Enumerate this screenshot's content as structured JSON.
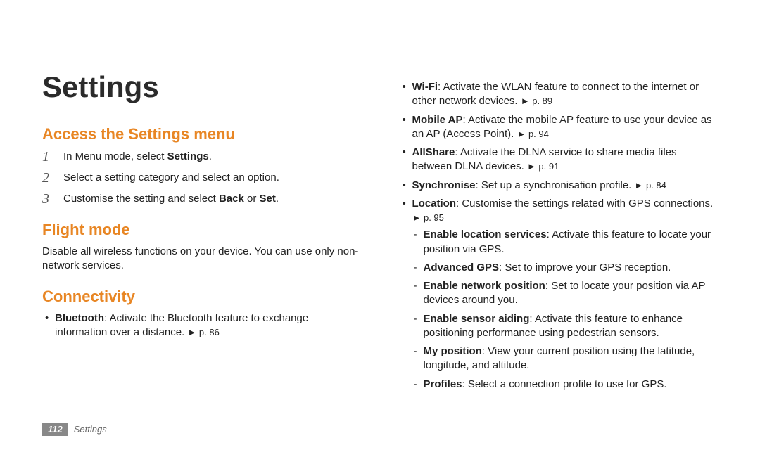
{
  "title": "Settings",
  "sections": {
    "access": {
      "heading": "Access the Settings menu",
      "steps": [
        {
          "n": "1",
          "pre": "In Menu mode, select ",
          "bold": "Settings",
          "post": "."
        },
        {
          "n": "2",
          "pre": "Select a setting category and select an option.",
          "bold": "",
          "post": ""
        },
        {
          "n": "3",
          "pre": "Customise the setting and select ",
          "bold": "Back",
          "mid": " or ",
          "bold2": "Set",
          "post": "."
        }
      ]
    },
    "flight": {
      "heading": "Flight mode",
      "body": "Disable all wireless functions on your device. You can use only non-network services."
    },
    "connectivity": {
      "heading": "Connectivity",
      "left_items": [
        {
          "term": "Bluetooth",
          "desc": ": Activate the Bluetooth feature to exchange information over a distance. ",
          "ref": "► p. 86"
        }
      ],
      "right_items": [
        {
          "term": "Wi-Fi",
          "desc": ": Activate the WLAN feature to connect to the internet or other network devices. ",
          "ref": "► p. 89"
        },
        {
          "term": "Mobile AP",
          "desc": ": Activate the mobile AP feature to use your device as an AP (Access Point). ",
          "ref": "► p. 94"
        },
        {
          "term": "AllShare",
          "desc": ": Activate the DLNA service to share media files between DLNA devices. ",
          "ref": "► p. 91"
        },
        {
          "term": "Synchronise",
          "desc": ": Set up a synchronisation profile. ",
          "ref": "► p. 84"
        },
        {
          "term": "Location",
          "desc": ": Customise the settings related with GPS connections. ",
          "ref": "► p. 95",
          "sub": [
            {
              "term": "Enable location services",
              "desc": ": Activate this feature to locate your position via GPS."
            },
            {
              "term": "Advanced GPS",
              "desc": ": Set to improve your GPS reception."
            },
            {
              "term": "Enable network position",
              "desc": ": Set to locate your position via AP devices around you."
            },
            {
              "term": "Enable sensor aiding",
              "desc": ": Activate this feature to enhance positioning performance using pedestrian sensors."
            },
            {
              "term": "My position",
              "desc": ": View your current position using the latitude, longitude, and altitude."
            },
            {
              "term": "Profiles",
              "desc": ": Select a connection profile to use for GPS."
            }
          ]
        }
      ]
    }
  },
  "footer": {
    "page": "112",
    "label": "Settings"
  }
}
